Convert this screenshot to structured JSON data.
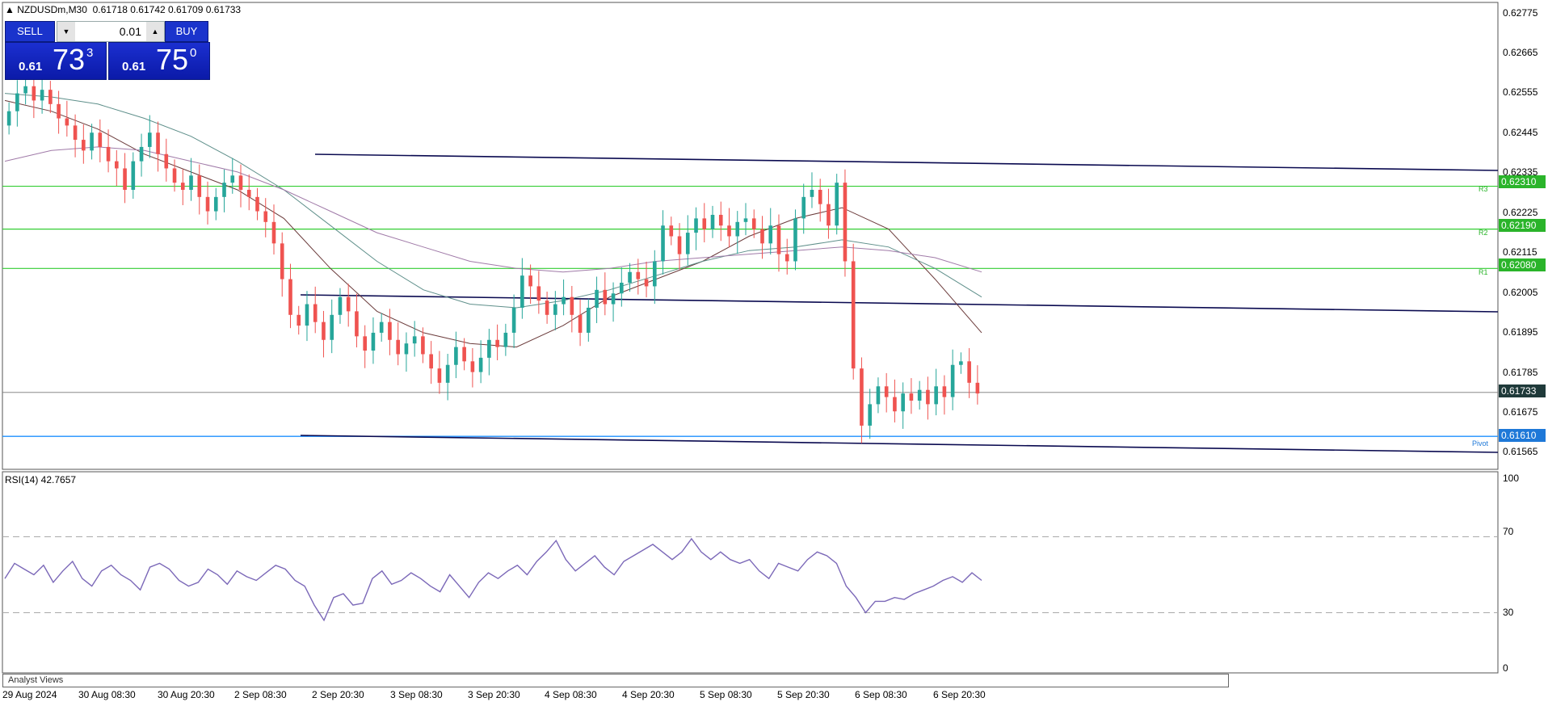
{
  "header": {
    "symbol_info": "NZDUSDm,M30",
    "ohlc": "0.61718 0.61742 0.61709 0.61733"
  },
  "trade_panel": {
    "sell_label": "SELL",
    "buy_label": "BUY",
    "lot_value": "0.01",
    "sell_small": "0.61",
    "sell_big": "73",
    "sell_sup": "3",
    "buy_small": "0.61",
    "buy_big": "75",
    "buy_sup": "0"
  },
  "price_axis": {
    "labels": [
      "0.62775",
      "0.62665",
      "0.62555",
      "0.62445",
      "0.62335",
      "0.62225",
      "0.62115",
      "0.62005",
      "0.61895",
      "0.61785",
      "0.61675",
      "0.61565"
    ],
    "current_price": "0.61733",
    "pivot_price": "0.61610",
    "levels": [
      {
        "value": "0.62310",
        "tag": "R3"
      },
      {
        "value": "0.62190",
        "tag": "R2"
      },
      {
        "value": "0.62080",
        "tag": "R1"
      }
    ],
    "pivot_tag": "Pivot"
  },
  "rsi": {
    "title": "RSI(14) 42.7657",
    "levels": [
      "100",
      "70",
      "30",
      "0"
    ]
  },
  "time_axis": [
    "29 Aug 2024",
    "30 Aug 08:30",
    "30 Aug 20:30",
    "2 Sep 08:30",
    "2 Sep 20:30",
    "3 Sep 08:30",
    "3 Sep 20:30",
    "4 Sep 08:30",
    "4 Sep 20:30",
    "5 Sep 08:30",
    "5 Sep 20:30",
    "6 Sep 08:30",
    "6 Sep 20:30"
  ],
  "bottom_panel": {
    "label": "Analyst Views"
  },
  "colors": {
    "bull": "#26a69a",
    "bear": "#ef5350",
    "level_line": "#32cd32",
    "pivot": "#1e90ff",
    "trend": "#0a0a50",
    "rsi": "#7b68b8"
  },
  "chart_data": {
    "type": "candlestick",
    "symbol": "NZDUSDm",
    "timeframe": "M30",
    "y_range": [
      0.6152,
      0.6282
    ],
    "x_ticks": [
      "29 Aug 2024",
      "30 Aug 08:30",
      "30 Aug 20:30",
      "2 Sep 08:30",
      "2 Sep 20:30",
      "3 Sep 08:30",
      "3 Sep 20:30",
      "4 Sep 08:30",
      "4 Sep 20:30",
      "5 Sep 08:30",
      "5 Sep 20:30",
      "6 Sep 08:30",
      "6 Sep 20:30"
    ],
    "close_series": [
      0.6252,
      0.6257,
      0.6259,
      0.6255,
      0.6258,
      0.6254,
      0.625,
      0.6248,
      0.6244,
      0.6241,
      0.6246,
      0.6242,
      0.6238,
      0.6236,
      0.623,
      0.6238,
      0.6242,
      0.6246,
      0.624,
      0.6236,
      0.6232,
      0.623,
      0.6234,
      0.6228,
      0.6224,
      0.6228,
      0.6232,
      0.6234,
      0.623,
      0.6228,
      0.6224,
      0.6221,
      0.6215,
      0.6205,
      0.6195,
      0.6192,
      0.6198,
      0.6193,
      0.6188,
      0.6195,
      0.62,
      0.6196,
      0.6189,
      0.6185,
      0.619,
      0.6193,
      0.6188,
      0.6184,
      0.6187,
      0.6189,
      0.6184,
      0.618,
      0.6176,
      0.6181,
      0.6186,
      0.6182,
      0.6179,
      0.6183,
      0.6188,
      0.6186,
      0.619,
      0.6197,
      0.6206,
      0.6203,
      0.6199,
      0.6195,
      0.6198,
      0.62,
      0.6195,
      0.619,
      0.6197,
      0.6202,
      0.6198,
      0.6201,
      0.6204,
      0.6207,
      0.6205,
      0.6203,
      0.621,
      0.622,
      0.6217,
      0.6212,
      0.6218,
      0.6222,
      0.6219,
      0.6223,
      0.622,
      0.6217,
      0.6221,
      0.6222,
      0.6219,
      0.6215,
      0.622,
      0.6212,
      0.621,
      0.6222,
      0.6228,
      0.623,
      0.6226,
      0.622,
      0.6232,
      0.621,
      0.618,
      0.6164,
      0.617,
      0.6175,
      0.6172,
      0.6168,
      0.6173,
      0.6171,
      0.6174,
      0.617,
      0.6175,
      0.6172,
      0.6181,
      0.6182,
      0.6176,
      0.6173
    ],
    "moving_averages": [
      {
        "values": [
          0.6255,
          0.6252,
          0.6247,
          0.624,
          0.6235,
          0.623,
          0.6222,
          0.6208,
          0.6196,
          0.619,
          0.6187,
          0.6186,
          0.6192,
          0.62,
          0.6205,
          0.621,
          0.6217,
          0.6222,
          0.6225,
          0.6219,
          0.6205,
          0.619
        ]
      },
      {
        "values": [
          0.6257,
          0.6256,
          0.6254,
          0.625,
          0.6245,
          0.6238,
          0.623,
          0.622,
          0.621,
          0.6202,
          0.6198,
          0.6197,
          0.6199,
          0.6202,
          0.6206,
          0.621,
          0.6213,
          0.6214,
          0.6216,
          0.6214,
          0.6208,
          0.62
        ]
      },
      {
        "values": [
          0.6238,
          0.6241,
          0.6242,
          0.6241,
          0.6238,
          0.6235,
          0.623,
          0.6224,
          0.6218,
          0.6214,
          0.621,
          0.6208,
          0.6207,
          0.6208,
          0.621,
          0.6211,
          0.6212,
          0.6213,
          0.6214,
          0.6213,
          0.6211,
          0.6207
        ]
      }
    ],
    "horizontal_levels": [
      0.6231,
      0.6219,
      0.6208,
      0.61733,
      0.6161
    ],
    "rsi_panel": {
      "title": "RSI(14) 42.7657",
      "ylim": [
        0,
        100
      ],
      "levels": [
        70,
        30
      ],
      "values": [
        48,
        56,
        53,
        50,
        55,
        46,
        52,
        57,
        48,
        44,
        52,
        55,
        50,
        47,
        42,
        54,
        56,
        53,
        47,
        44,
        46,
        53,
        50,
        45,
        52,
        49,
        47,
        51,
        55,
        53,
        47,
        44,
        34,
        26,
        38,
        40,
        34,
        35,
        48,
        52,
        45,
        47,
        51,
        48,
        44,
        41,
        50,
        44,
        38,
        46,
        51,
        48,
        52,
        55,
        50,
        57,
        62,
        68,
        58,
        52,
        56,
        60,
        54,
        50,
        57,
        60,
        63,
        66,
        62,
        58,
        62,
        69,
        62,
        58,
        62,
        58,
        56,
        58,
        52,
        48,
        56,
        54,
        52,
        58,
        62,
        60,
        56,
        44,
        38,
        30,
        36,
        36,
        38,
        37,
        40,
        42,
        44,
        47,
        49,
        46,
        51,
        47
      ]
    }
  }
}
